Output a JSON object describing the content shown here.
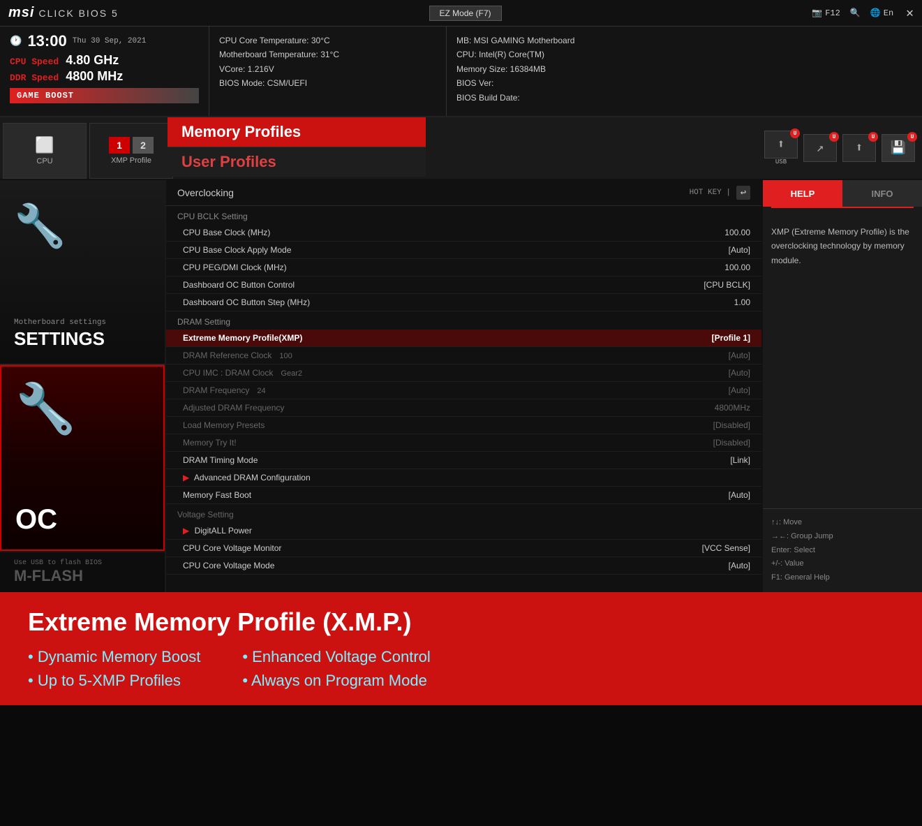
{
  "topbar": {
    "logo": "msi",
    "title": "CLICK BIOS 5",
    "ez_mode": "EZ Mode (F7)",
    "f12": "F12",
    "lang": "En",
    "close": "✕"
  },
  "infobar": {
    "clock": "13:00",
    "date": "Thu 30 Sep, 2021",
    "cpu_speed_label": "CPU Speed",
    "cpu_speed_value": "4.80 GHz",
    "ddr_speed_label": "DDR Speed",
    "ddr_speed_value": "4800 MHz",
    "game_boost": "GAME BOOST",
    "center": {
      "cpu_temp": "CPU Core Temperature: 30°C",
      "mb_temp": "Motherboard Temperature: 31°C",
      "vcore": "VCore: 1.216V",
      "bios_mode": "BIOS Mode: CSM/UEFI"
    },
    "right": {
      "mb": "MB: MSI GAMING Motherboard",
      "cpu": "CPU: Intel(R) Core(TM)",
      "mem": "Memory Size: 16384MB",
      "bios_ver": "BIOS Ver:",
      "bios_date": "BIOS Build Date:"
    }
  },
  "nav_tabs": {
    "cpu_label": "CPU",
    "xmp_label": "XMP Profile",
    "xmp_num1": "1",
    "xmp_num2": "2",
    "profiles_memory": "Memory Profiles",
    "profiles_user": "User Profiles",
    "usb_label": "USB"
  },
  "sidebar": {
    "settings_label": "Motherboard settings",
    "settings_title": "SETTINGS",
    "oc_title": "OC",
    "mflash_label": "Use USB to flash BIOS",
    "mflash_title": "M-FLASH"
  },
  "oc_panel": {
    "title": "Overclocking",
    "hotkey": "HOT KEY  |",
    "sections": [
      {
        "header": "CPU BCLK Setting",
        "items": [
          {
            "name": "CPU Base Clock (MHz)",
            "value": "100.00",
            "dimmed": false,
            "highlighted": false
          },
          {
            "name": "CPU Base Clock Apply Mode",
            "value": "[Auto]",
            "dimmed": false,
            "highlighted": false
          },
          {
            "name": "CPU PEG/DMI Clock (MHz)",
            "value": "100.00",
            "dimmed": false,
            "highlighted": false
          },
          {
            "name": "Dashboard OC Button Control",
            "value": "[CPU BCLK]",
            "dimmed": false,
            "highlighted": false
          },
          {
            "name": "Dashboard OC Button Step (MHz)",
            "value": "1.00",
            "dimmed": false,
            "highlighted": false
          }
        ]
      },
      {
        "header": "DRAM Setting",
        "items": [
          {
            "name": "Extreme Memory Profile(XMP)",
            "value": "[Profile 1]",
            "dimmed": false,
            "highlighted": true
          },
          {
            "name": "DRAM Reference Clock",
            "value": "[Auto]",
            "dimmed": true,
            "sub": "100"
          },
          {
            "name": "CPU IMC : DRAM Clock",
            "value": "[Auto]",
            "dimmed": true,
            "sub": "Gear2"
          },
          {
            "name": "DRAM Frequency",
            "value": "[Auto]",
            "dimmed": true,
            "sub": "24"
          },
          {
            "name": "Adjusted DRAM Frequency",
            "value": "4800MHz",
            "dimmed": true
          },
          {
            "name": "Load Memory Presets",
            "value": "[Disabled]",
            "dimmed": true
          },
          {
            "name": "Memory Try It!",
            "value": "[Disabled]",
            "dimmed": true
          },
          {
            "name": "DRAM Timing Mode",
            "value": "[Link]",
            "dimmed": false
          },
          {
            "name": "Advanced DRAM Configuration",
            "value": "",
            "dimmed": false,
            "arrow": true
          },
          {
            "name": "Memory Fast Boot",
            "value": "[Auto]",
            "dimmed": false
          }
        ]
      },
      {
        "header": "Voltage Setting",
        "items": [
          {
            "name": "DigitALL Power",
            "value": "",
            "dimmed": false,
            "arrow": true
          },
          {
            "name": "CPU Core Voltage Monitor",
            "value": "[VCC Sense]",
            "dimmed": false
          },
          {
            "name": "CPU Core Voltage Mode",
            "value": "[Auto]",
            "dimmed": false
          }
        ]
      }
    ]
  },
  "help_panel": {
    "tab_help": "HELP",
    "tab_info": "INFO",
    "content": "XMP (Extreme Memory Profile) is the overclocking technology by memory module.",
    "shortcuts": [
      "↑↓: Move",
      "→←: Group Jump",
      "Enter: Select",
      "+/-: Value",
      "F1: General Help"
    ]
  },
  "bottom_banner": {
    "title": "Extreme Memory Profile (X.M.P.)",
    "col1": [
      "Dynamic Memory Boost",
      "Up to 5-XMP Profiles"
    ],
    "col2": [
      "Enhanced Voltage Control",
      "Always on Program Mode"
    ]
  }
}
